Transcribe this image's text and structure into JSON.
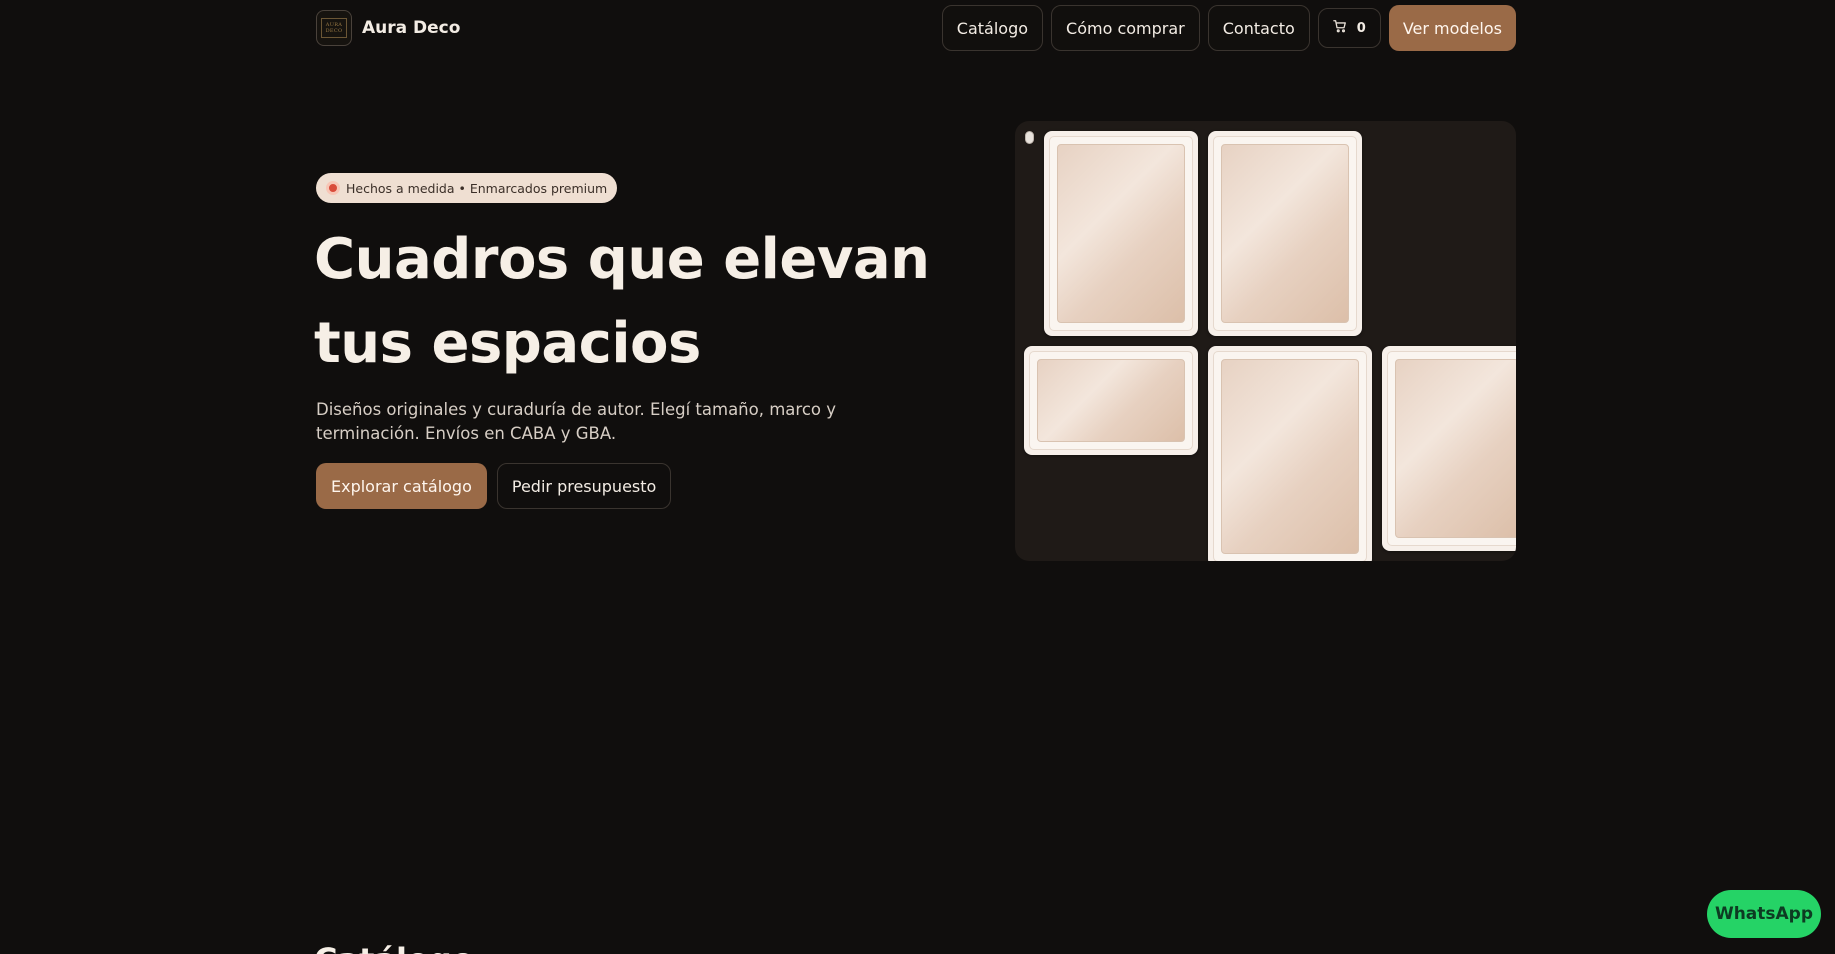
{
  "brand": {
    "logo_top": "AURA",
    "logo_bottom": "DECO",
    "name": "Aura Deco"
  },
  "nav": {
    "items": [
      {
        "label": "Catálogo"
      },
      {
        "label": "Cómo comprar"
      },
      {
        "label": "Contacto"
      }
    ],
    "cart_icon": "cart-icon",
    "cart_count": "0",
    "cta_label": "Ver modelos"
  },
  "hero": {
    "badge_icon": "target-icon",
    "badge_text": "Hechos a medida • Enmarcados premium",
    "title_line1": "Cuadros que elevan",
    "title_line2": "tus espacios",
    "description": "Diseños originales y curaduría de autor. Elegí tamaño, marco y terminación. Envíos en CABA y GBA.",
    "primary_action": "Explorar catálogo",
    "secondary_action": "Pedir presupuesto"
  },
  "gallery": {
    "frames": [
      "frame-1",
      "frame-2",
      "frame-3",
      "frame-4",
      "frame-5"
    ]
  },
  "floating": {
    "whatsapp_label": "WhatsApp"
  },
  "next_section": {
    "title": "Catálogo"
  },
  "colors": {
    "background": "#100e0d",
    "accent": "#9a6a47",
    "whatsapp": "#25d366",
    "badge_bg": "#efdfd2"
  }
}
